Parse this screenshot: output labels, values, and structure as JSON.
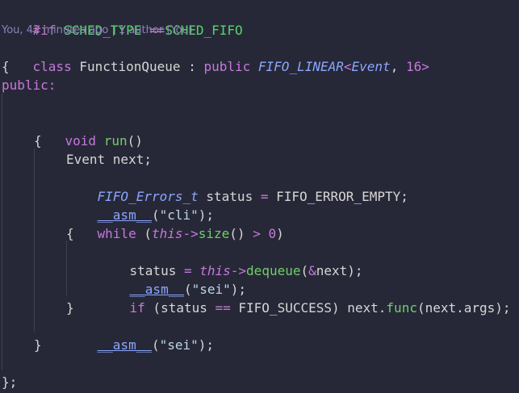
{
  "code": {
    "l1": {
      "a": "#if",
      "b": " ",
      "c": "SCHED_TYPE",
      "d": " ==",
      "e": "SCHED_FIFO"
    },
    "blame": "You, 42 minutes ago | 1 author (You)",
    "l2": {
      "a": "class",
      "b": " FunctionQueue : ",
      "c": "public",
      "d": " ",
      "e": "FIFO_LINEAR",
      "f": "<",
      "g": "Event",
      "h": ", ",
      "i": "16",
      "j": ">"
    },
    "l3": "{",
    "l4": "public:",
    "l5": {
      "a": "void",
      "b": " ",
      "c": "run",
      "d": "()"
    },
    "l6": "{",
    "l7": "Event next;",
    "l8": {
      "a": "FIFO_Errors_t",
      "b": " status ",
      "c": "=",
      "d": " FIFO_ERROR_EMPTY;"
    },
    "l9": {
      "a": "__asm__",
      "b": "(",
      "c": "\"cli\"",
      "d": ");"
    },
    "l10": {
      "a": "while",
      "b": " (",
      "c": "this",
      "d": "->",
      "e": "size",
      "f": "() ",
      "g": ">",
      "h": " ",
      "i": "0",
      "j": ")"
    },
    "l11": "{",
    "l12": {
      "a": "status ",
      "b": "=",
      "c": " ",
      "d": "this",
      "e": "->",
      "f": "dequeue",
      "g": "(",
      "h": "&",
      "i": "next);"
    },
    "l13": {
      "a": "__asm__",
      "b": "(",
      "c": "\"sei\"",
      "d": ");"
    },
    "l14": {
      "a": "if",
      "b": " (status ",
      "c": "==",
      "d": " FIFO_SUCCESS) next.",
      "e": "func",
      "f": "(next.args);"
    },
    "l15": "}",
    "l16": {
      "a": "__asm__",
      "b": "(",
      "c": "\"sei\"",
      "d": ");"
    },
    "l17": "}",
    "l18": "};"
  },
  "colors": {
    "background": "#272837",
    "keyword": "#c678dd",
    "type": "#8aa7ff",
    "function": "#6fcf6a",
    "string": "#b9d6e8"
  }
}
